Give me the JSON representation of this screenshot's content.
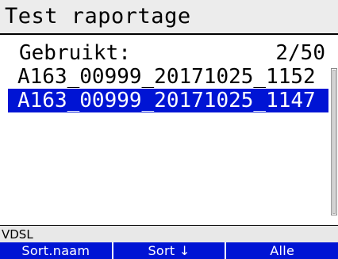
{
  "window": {
    "title": "Test raportage"
  },
  "summary": {
    "used_label": "Gebruikt:",
    "used_count": "2/50"
  },
  "files": [
    {
      "name": "A163_00999_20171025_1152",
      "selected": false
    },
    {
      "name": "A163_00999_20171025_1147",
      "selected": true
    }
  ],
  "status": {
    "mode": "VDSL"
  },
  "softkeys": [
    {
      "label": "Sort.naam"
    },
    {
      "label": "Sort ↓"
    },
    {
      "label": "Alle"
    }
  ],
  "colors": {
    "selection": "#0014d4",
    "softkey_bar": "#0014d4",
    "title_bg": "#ececec"
  }
}
